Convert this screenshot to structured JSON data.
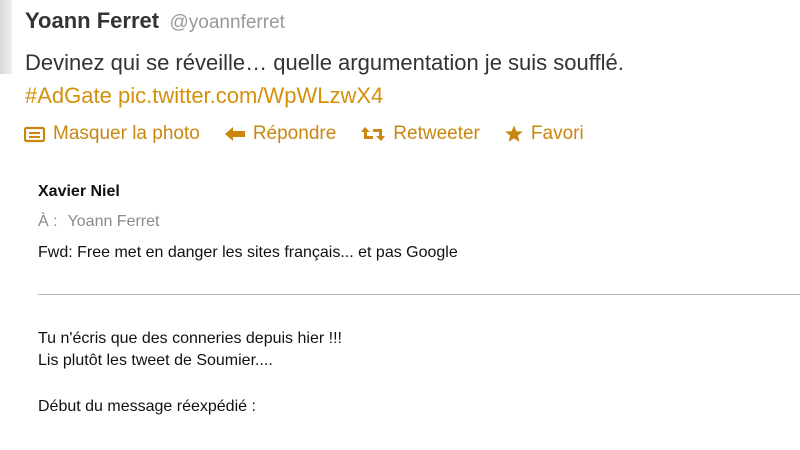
{
  "tweet": {
    "author_name": "Yoann Ferret",
    "author_handle": "@yoannferret",
    "text_line1": "Devinez qui se réveille… quelle argumentation je suis soufflé.",
    "hashtag": "#AdGate",
    "photo_link": "pic.twitter.com/WpWLzwX4"
  },
  "actions": {
    "hide_photo": "Masquer la photo",
    "reply": "Répondre",
    "retweet": "Retweeter",
    "favorite": "Favori"
  },
  "icons": [
    "photo-icon",
    "reply-icon",
    "retweet-icon",
    "star-icon"
  ],
  "colors": {
    "link": "#d4900a",
    "action": "#c9870e",
    "handle": "#999999"
  },
  "email": {
    "sender": "Xavier Niel",
    "to_label": "À :",
    "to_value": "Yoann Ferret",
    "subject": "Fwd: Free met en danger les sites français... et pas Google",
    "body_line1": "Tu n'écris que des conneries depuis hier !!!",
    "body_line2": "Lis plutôt les tweet de Soumier....",
    "body_line3": "Début du message réexpédié :"
  }
}
